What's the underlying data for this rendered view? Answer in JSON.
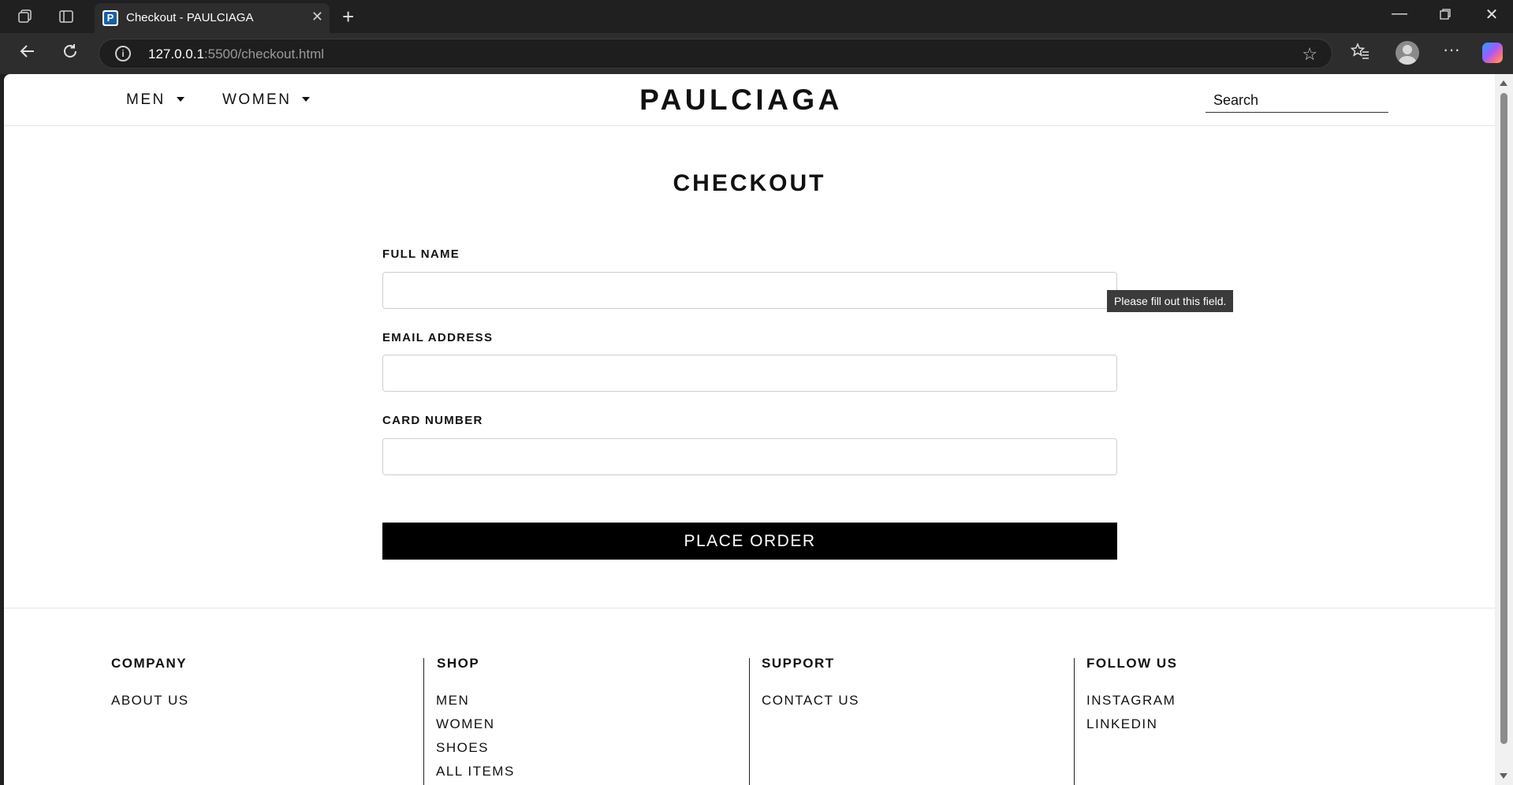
{
  "browser": {
    "tab_title": "Checkout - PAULCIAGA",
    "tab_favicon_letter": "P",
    "url_host": "127.0.0.1",
    "url_path": ":5500/checkout.html"
  },
  "header": {
    "menu": [
      {
        "label": "MEN"
      },
      {
        "label": "WOMEN"
      }
    ],
    "logo": "PAULCIAGA",
    "search_placeholder": "Search"
  },
  "checkout": {
    "title": "CHECKOUT",
    "fields": [
      {
        "label": "FULL NAME",
        "value": ""
      },
      {
        "label": "EMAIL ADDRESS",
        "value": ""
      },
      {
        "label": "CARD NUMBER",
        "value": ""
      }
    ],
    "validation_tooltip": "Please fill out this field.",
    "submit_label": "PLACE ORDER"
  },
  "footer": {
    "columns": [
      {
        "heading": "COMPANY",
        "links": [
          "ABOUT US"
        ]
      },
      {
        "heading": "SHOP",
        "links": [
          "MEN",
          "WOMEN",
          "SHOES",
          "ALL ITEMS"
        ]
      },
      {
        "heading": "SUPPORT",
        "links": [
          "CONTACT US"
        ]
      },
      {
        "heading": "FOLLOW US",
        "links": [
          "INSTAGRAM",
          "LINKEDIN"
        ]
      }
    ]
  },
  "icons": {
    "workspaces": "workspaces-icon",
    "tab_actions": "tab-actions-icon",
    "back": "back-arrow-icon",
    "refresh": "refresh-icon",
    "site_info": "info-icon",
    "favorite": "star-icon",
    "favorites_bar": "favorites-icon",
    "profile": "profile-icon",
    "more": "more-icon",
    "copilot": "copilot-icon"
  }
}
